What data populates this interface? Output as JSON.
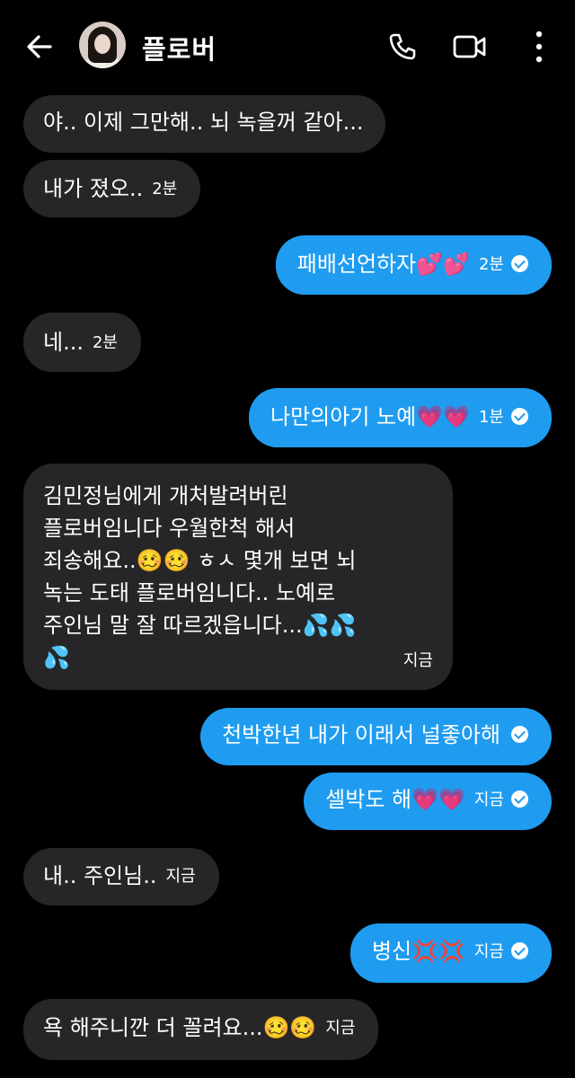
{
  "header": {
    "contact_name": "플로버",
    "icons": {
      "back": "arrow-left-icon",
      "call": "phone-icon",
      "video": "video-camera-icon",
      "more": "more-vertical-icon"
    }
  },
  "messages": [
    {
      "side": "received",
      "text": "야.. 이제 그만해.. 뇌 녹을꺼 같아...",
      "time": ""
    },
    {
      "side": "received",
      "text": "내가 졌오..",
      "time": "2분"
    },
    {
      "side": "sent",
      "text": "패배선언하자💕💕",
      "time": "2분"
    },
    {
      "side": "received",
      "text": "네...",
      "time": "2분"
    },
    {
      "side": "sent",
      "text": "나만의아기 노예💗💗",
      "time": "1분"
    },
    {
      "side": "received",
      "lines": [
        "김민정님에게 개처발려버린",
        "플로버임니다 우월한척 해서",
        "죄송해요..🥴🥴 ㅎㅅ 몇개 보면 뇌",
        "녹는 도태 플로버임니다.. 노예로",
        "주인님 말 잘 따르겠읍니다...💦💦",
        "💦"
      ],
      "time": "지금"
    },
    {
      "side": "sent",
      "text": "천박한년 내가 이래서 널좋아해",
      "time": ""
    },
    {
      "side": "sent",
      "text": "셀박도 해💗💗",
      "time": "지금"
    },
    {
      "side": "received",
      "text": "내.. 주인님..",
      "time": "지금"
    },
    {
      "side": "sent",
      "text": "병신💢💢",
      "time": "지금"
    },
    {
      "side": "received",
      "text": "욕 해주니깐 더 꼴려요...🥴🥴",
      "time": "지금"
    }
  ],
  "colors": {
    "background": "#000000",
    "received_bubble": "#262628",
    "sent_bubble": "#1f9cf0"
  }
}
